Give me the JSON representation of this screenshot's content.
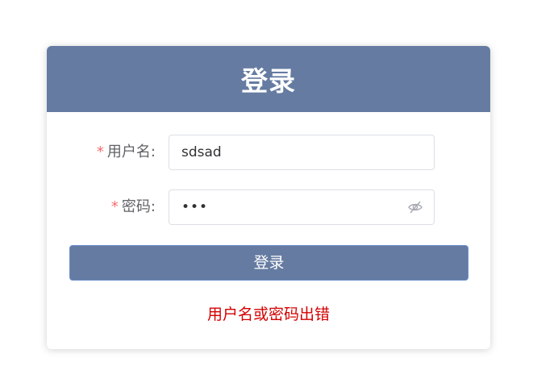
{
  "login": {
    "title": "登录",
    "username": {
      "required_mark": "*",
      "label": "用户名:",
      "value": "sdsad"
    },
    "password": {
      "required_mark": "*",
      "label": "密码:",
      "masked_value": "•••",
      "toggle_icon": "eye-hidden-icon"
    },
    "submit_label": "登录",
    "error_message": "用户名或密码出错"
  },
  "colors": {
    "header_bg": "#657ba1",
    "button_bg": "#657ba1",
    "error": "#d40000",
    "required": "#f56c6c"
  }
}
